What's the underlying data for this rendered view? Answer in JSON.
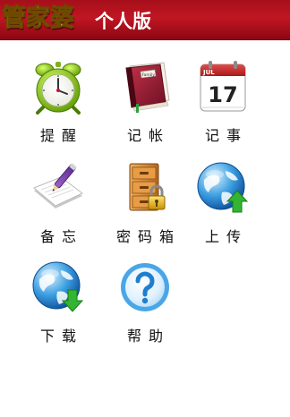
{
  "header": {
    "brand": "管家婆",
    "edition": "个人版"
  },
  "menu": [
    {
      "label": "提醒",
      "icon": "alarm-clock-icon"
    },
    {
      "label": "记帐",
      "icon": "ledger-book-icon"
    },
    {
      "label": "记事",
      "icon": "calendar-icon"
    },
    {
      "label": "备忘",
      "icon": "notepad-pen-icon"
    },
    {
      "label": "密码箱",
      "icon": "locked-cabinet-icon"
    },
    {
      "label": "上传",
      "icon": "globe-upload-icon"
    },
    {
      "label": "下载",
      "icon": "globe-download-icon"
    },
    {
      "label": "帮助",
      "icon": "help-question-icon"
    }
  ],
  "calendar_icon": {
    "month": "JUL",
    "day": "17"
  },
  "ledger_icon": {
    "cover_text": "Family"
  },
  "colors": {
    "title_bar": "#b3121d",
    "brand_text": "#f8e419",
    "edition_text": "#ffffff"
  }
}
